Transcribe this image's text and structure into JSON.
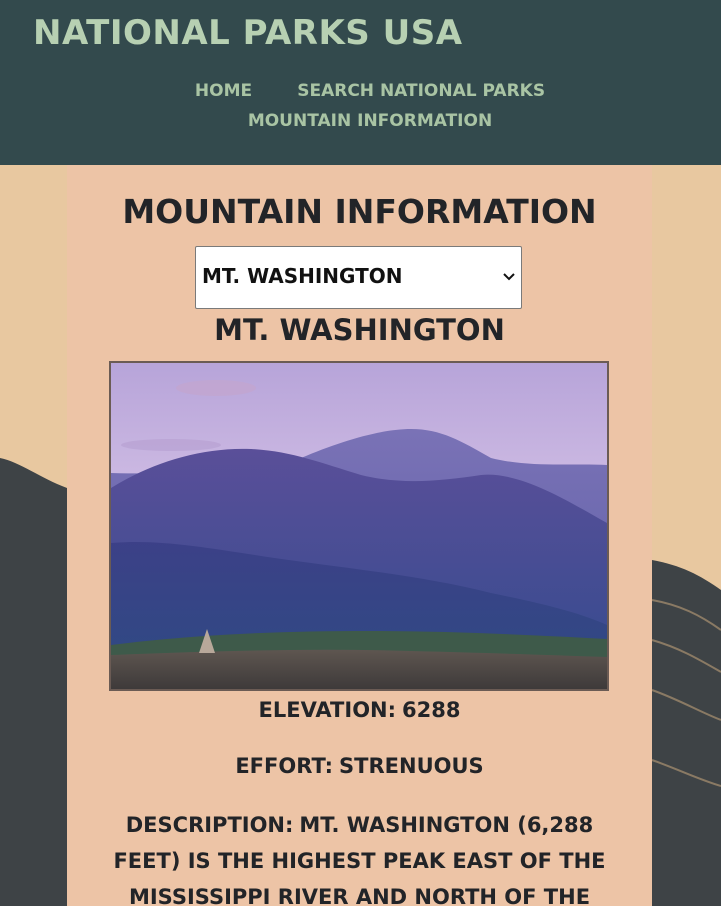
{
  "site": {
    "title": "National Parks USA"
  },
  "nav": {
    "items": [
      {
        "label": "Home"
      },
      {
        "label": "Search National Parks"
      },
      {
        "label": "Mountain Information"
      }
    ]
  },
  "main": {
    "heading": "Mountain Information",
    "selector": {
      "selected": "Mt. Washington"
    },
    "mountain": {
      "name": "Mt. Washington",
      "elevation_label": "Elevation:",
      "elevation_value": "6288",
      "effort_label": "Effort:",
      "effort_value": "Strenuous",
      "description_label": "Description:",
      "description_value": "Mt. Washington (6,288 feet) is the highest peak east of the Mississippi River and north of the"
    }
  },
  "colors": {
    "header_bg": "#334a4d",
    "header_text": "#b7d0b2",
    "panel_bg": "#edc4a6",
    "page_bg": "#e8c8a0",
    "text_dark": "#222428"
  },
  "icons": {
    "select_arrow": "chevron-down-icon"
  }
}
